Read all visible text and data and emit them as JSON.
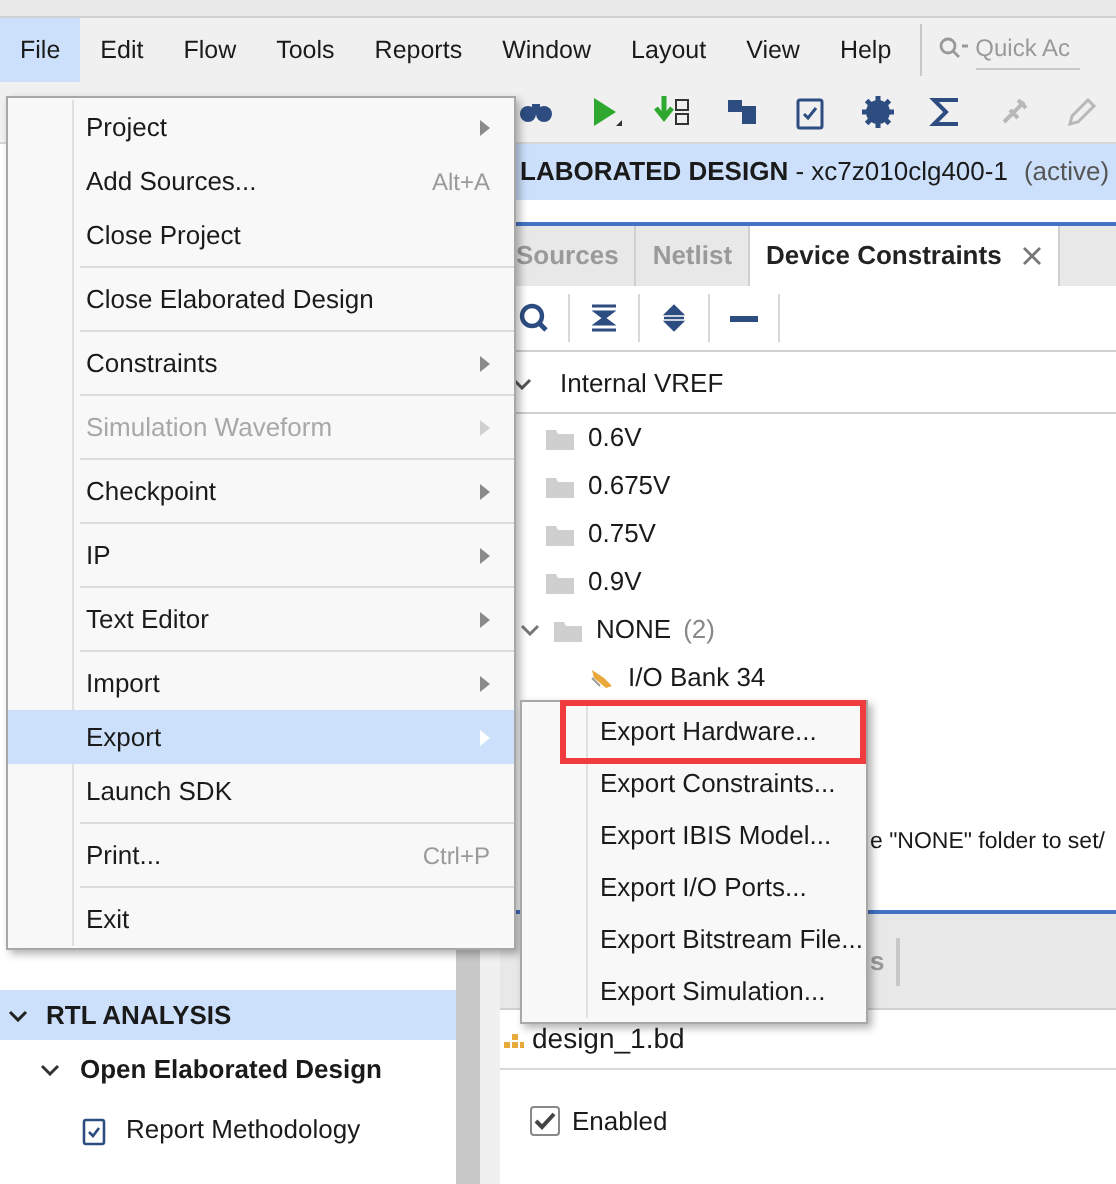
{
  "menu_bar": [
    {
      "label": "File",
      "selected": true
    },
    {
      "label": "Edit",
      "selected": false
    },
    {
      "label": "Flow",
      "selected": false
    },
    {
      "label": "Tools",
      "selected": false
    },
    {
      "label": "Reports",
      "selected": false
    },
    {
      "label": "Window",
      "selected": false
    },
    {
      "label": "Layout",
      "selected": false
    },
    {
      "label": "View",
      "selected": false
    },
    {
      "label": "Help",
      "selected": false
    }
  ],
  "quick_access": {
    "placeholder": "Quick Ac"
  },
  "design_header": {
    "title": "LABORATED DESIGN",
    "part": " - xc7z010clg400-1",
    "status": "(active)"
  },
  "tabs": [
    {
      "label": "Sources",
      "selected": false
    },
    {
      "label": "Netlist",
      "selected": false
    },
    {
      "label": "Device Constraints",
      "selected": true,
      "closable": true
    }
  ],
  "tree": {
    "label": "Internal VREF",
    "expanded": true,
    "children": [
      {
        "label": "0.6V",
        "kind": "folder"
      },
      {
        "label": "0.675V",
        "kind": "folder"
      },
      {
        "label": "0.75V",
        "kind": "folder"
      },
      {
        "label": "0.9V",
        "kind": "folder"
      },
      {
        "label": "NONE",
        "count": "(2)",
        "kind": "folder",
        "expanded": true,
        "children": [
          {
            "label": "I/O Bank 34",
            "kind": "bank"
          }
        ]
      }
    ]
  },
  "hint_text": "e \"NONE\" folder to set/",
  "lower_tab": "s",
  "design_file": "design_1.bd",
  "enabled": {
    "label": "Enabled",
    "checked": true
  },
  "flow_navigator": {
    "section": {
      "label": "RTL ANALYSIS",
      "expanded": true
    },
    "items": [
      {
        "label": "Open Elaborated Design",
        "kind": "group",
        "expanded": true
      },
      {
        "label": "Report Methodology",
        "kind": "task"
      }
    ]
  },
  "file_menu": [
    {
      "kind": "item",
      "label": "Project",
      "submenu": true,
      "disabled": false,
      "selected": false
    },
    {
      "kind": "item",
      "label": "Add Sources...",
      "shortcut": "Alt+A",
      "submenu": false,
      "disabled": false,
      "selected": false
    },
    {
      "kind": "item",
      "label": "Close Project",
      "submenu": false,
      "disabled": false,
      "selected": false
    },
    {
      "kind": "separator"
    },
    {
      "kind": "item",
      "label": "Close Elaborated Design",
      "submenu": false,
      "disabled": false,
      "selected": false
    },
    {
      "kind": "separator"
    },
    {
      "kind": "item",
      "label": "Constraints",
      "submenu": true,
      "disabled": false,
      "selected": false
    },
    {
      "kind": "separator"
    },
    {
      "kind": "item",
      "label": "Simulation Waveform",
      "submenu": true,
      "disabled": true,
      "selected": false
    },
    {
      "kind": "separator"
    },
    {
      "kind": "item",
      "label": "Checkpoint",
      "submenu": true,
      "disabled": false,
      "selected": false
    },
    {
      "kind": "separator"
    },
    {
      "kind": "item",
      "label": "IP",
      "submenu": true,
      "disabled": false,
      "selected": false
    },
    {
      "kind": "separator"
    },
    {
      "kind": "item",
      "label": "Text Editor",
      "submenu": true,
      "disabled": false,
      "selected": false
    },
    {
      "kind": "separator"
    },
    {
      "kind": "item",
      "label": "Import",
      "submenu": true,
      "disabled": false,
      "selected": false
    },
    {
      "kind": "item",
      "label": "Export",
      "submenu": true,
      "disabled": false,
      "selected": true
    },
    {
      "kind": "item",
      "label": "Launch SDK",
      "submenu": false,
      "disabled": false,
      "selected": false
    },
    {
      "kind": "separator"
    },
    {
      "kind": "item",
      "label": "Print...",
      "shortcut": "Ctrl+P",
      "submenu": false,
      "disabled": false,
      "selected": false
    },
    {
      "kind": "separator"
    },
    {
      "kind": "item",
      "label": "Exit",
      "submenu": false,
      "disabled": false,
      "selected": false
    }
  ],
  "export_submenu": [
    {
      "label": "Export Hardware...",
      "highlighted": true
    },
    {
      "label": "Export Constraints...",
      "highlighted": false
    },
    {
      "label": "Export IBIS Model...",
      "highlighted": false
    },
    {
      "label": "Export I/O Ports...",
      "highlighted": false
    },
    {
      "label": "Export Bitstream File...",
      "highlighted": false
    },
    {
      "label": "Export Simulation...",
      "highlighted": false
    }
  ]
}
